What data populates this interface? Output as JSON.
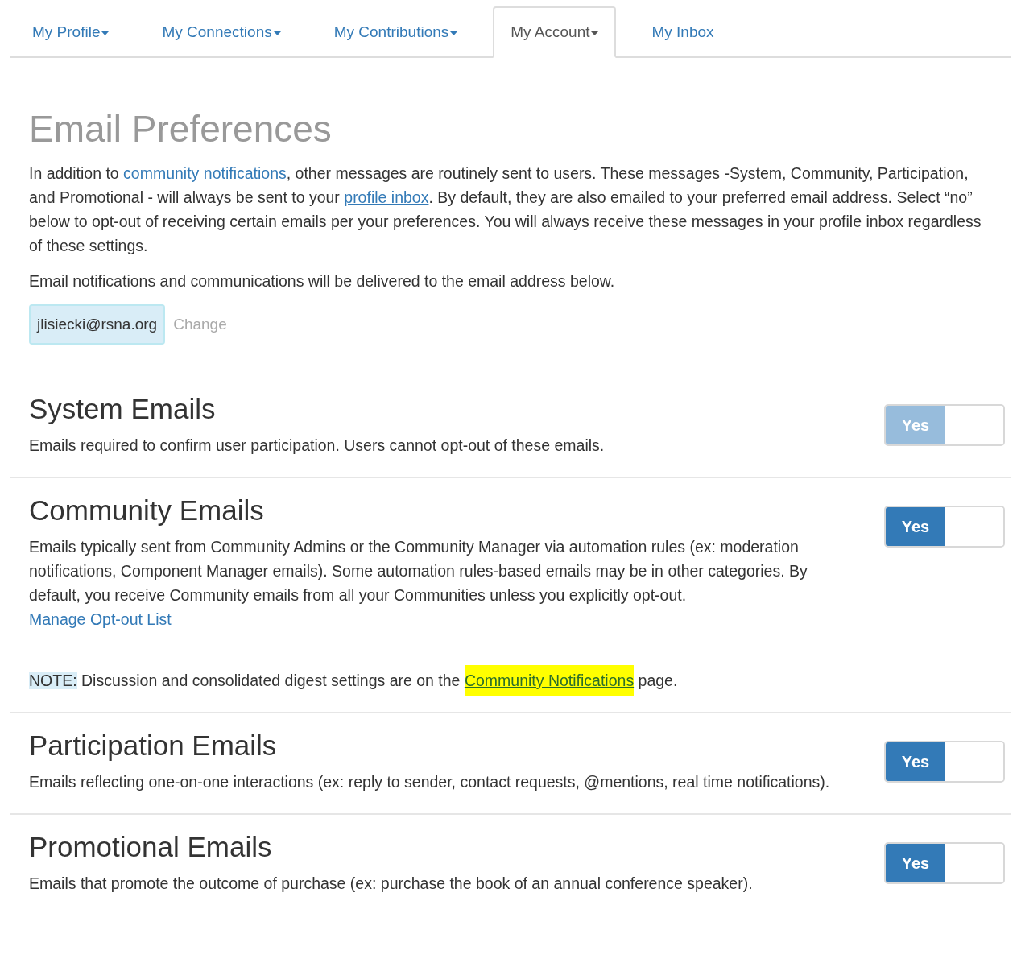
{
  "tabs": [
    {
      "label": "My Profile",
      "dropdown": true,
      "selected": false
    },
    {
      "label": "My Connections",
      "dropdown": true,
      "selected": false
    },
    {
      "label": "My Contributions",
      "dropdown": true,
      "selected": false
    },
    {
      "label": "My Account",
      "dropdown": true,
      "selected": true
    },
    {
      "label": "My Inbox",
      "dropdown": false,
      "selected": false
    }
  ],
  "title": "Email Preferences",
  "intro": [
    {
      "kind": "text",
      "text": "In addition to "
    },
    {
      "kind": "link",
      "text": "community notifications"
    },
    {
      "kind": "text",
      "text": ", other messages are routinely sent to users. These messages -System, Community, Participation, and Promotional - will always be sent to your "
    },
    {
      "kind": "link",
      "text": "profile inbox"
    },
    {
      "kind": "text",
      "text": ". By default, they are also emailed to your preferred email address. Select “no” below to opt-out of receiving certain emails per your preferences. You will always receive these messages in your profile inbox regardless of these settings."
    }
  ],
  "delivery_note": "Email notifications and communications will be delivered to the email address below.",
  "email": "jlisiecki@rsna.org",
  "change_link": "Change",
  "sections": [
    {
      "title": "System Emails",
      "description": "Emails required to confirm user participation. Users cannot opt-out of these emails.",
      "toggle": {
        "label": "Yes",
        "on": true,
        "disabled": true
      }
    },
    {
      "title": "Community Emails",
      "description": "Emails typically sent from Community Admins or the Community Manager via automation rules (ex: moderation notifications, Component Manager emails). Some automation rules-based emails may be in other categories. By default, you receive Community emails from all your Communities unless you explicitly opt-out.",
      "link": "Manage Opt-out List",
      "note": {
        "label": "NOTE:",
        "before": " Discussion and consolidated digest settings are on the ",
        "link": "Community Notifications",
        "link_highlighted": true,
        "after": " page."
      },
      "toggle": {
        "label": "Yes",
        "on": true,
        "disabled": false
      }
    },
    {
      "title": "Participation Emails",
      "description": "Emails reflecting one-on-one interactions (ex: reply to sender, contact requests, @mentions, real time notifications).",
      "toggle": {
        "label": "Yes",
        "on": true,
        "disabled": false
      }
    },
    {
      "title": "Promotional Emails",
      "description": "Emails that promote the outcome of purchase (ex: purchase the book of an annual conference speaker).",
      "toggle": {
        "label": "Yes",
        "on": true,
        "disabled": false
      }
    }
  ]
}
